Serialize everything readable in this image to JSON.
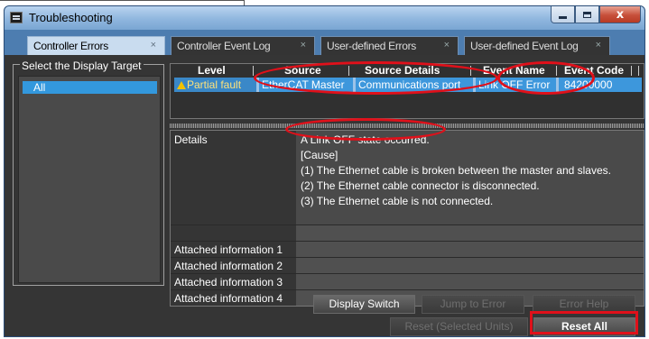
{
  "window": {
    "title": "Troubleshooting",
    "close_glyph": "x"
  },
  "tabs": [
    {
      "label": "Controller Errors",
      "close": "×"
    },
    {
      "label": "Controller Event Log",
      "close": "×"
    },
    {
      "label": "User-defined Errors",
      "close": "×"
    },
    {
      "label": "User-defined Event Log",
      "close": "×"
    }
  ],
  "target_panel": {
    "label": "Select the Display Target",
    "items": [
      "All"
    ]
  },
  "error_table": {
    "columns": [
      "Level",
      "Source",
      "Source Details",
      "Event Name",
      "Event Code"
    ],
    "rows": [
      {
        "level": "Partial fault",
        "source": "EtherCAT Master",
        "source_details": "Communications port",
        "event_name": "Link OFF Error",
        "event_code": "84200000"
      }
    ]
  },
  "details": {
    "label": "Details",
    "lines": [
      "A Link OFF state occurred.",
      "[Cause]",
      "(1) The Ethernet cable is broken between the master and slaves.",
      "(2) The Ethernet cable connector is disconnected.",
      "(3) The Ethernet cable is not connected."
    ],
    "attached": [
      "Attached information 1",
      "Attached information 2",
      "Attached information 3",
      "Attached information 4"
    ]
  },
  "buttons": {
    "display_switch": "Display Switch",
    "jump_to_error": "Jump to Error",
    "error_help": "Error Help",
    "reset_selected": "Reset (Selected Units)",
    "reset_all": "Reset All"
  },
  "colors": {
    "highlight": "#e0101a",
    "selection": "#3d97dc",
    "background": "#353535"
  }
}
